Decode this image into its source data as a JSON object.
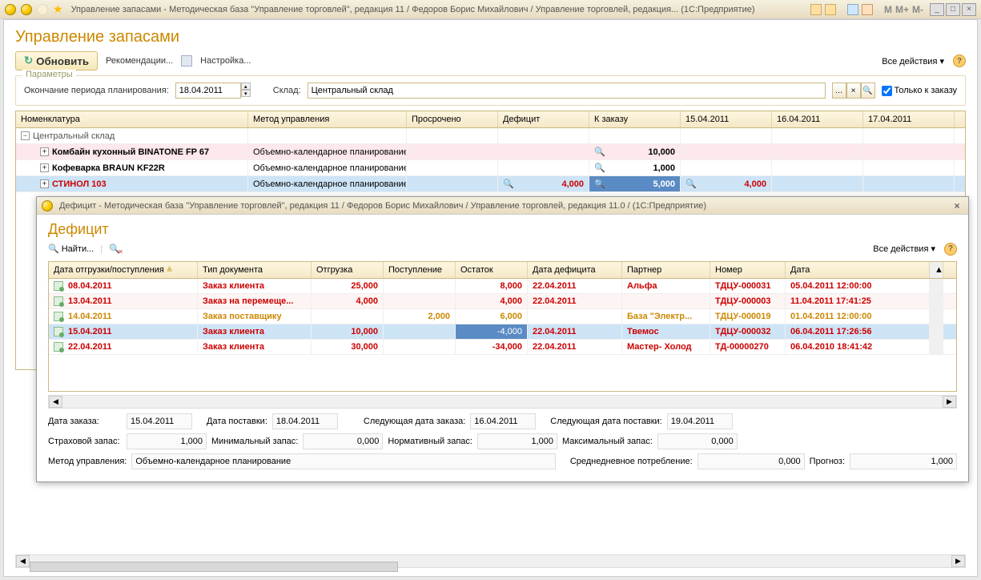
{
  "titlebar": "Управление запасами - Методическая база \"Управление торговлей\", редакция 11 / Федоров Борис Михайлович / Управление торговлей, редакция...  (1С:Предприятие)",
  "mem_labels": {
    "m": "M",
    "mplus": "M+",
    "mminus": "M-"
  },
  "page_title": "Управление запасами",
  "toolbar": {
    "refresh": "Обновить",
    "recommend": "Рекомендации...",
    "settings": "Настройка...",
    "all_actions": "Все действия"
  },
  "params": {
    "legend": "Параметры",
    "plan_end_label": "Окончание периода планирования:",
    "plan_end_value": "18.04.2011",
    "warehouse_label": "Склад:",
    "warehouse_value": "Центральный склад",
    "only_to_order": "Только к заказу"
  },
  "grid": {
    "headers": {
      "nom": "Номенклатура",
      "met": "Метод управления",
      "pros": "Просрочено",
      "def": "Дефицит",
      "zak": "К заказу",
      "d1": "15.04.2011",
      "d2": "16.04.2011",
      "d3": "17.04.2011"
    },
    "group": "Центральный склад",
    "rows": [
      {
        "nom": "Комбайн кухонный BINATONE FP 67",
        "met": "Объемно-календарное планирование",
        "pros": "",
        "def": "",
        "zak": "10,000",
        "d1": "",
        "d2": "",
        "d3": ""
      },
      {
        "nom": "Кофеварка BRAUN KF22R",
        "met": "Объемно-календарное планирование",
        "pros": "",
        "def": "",
        "zak": "1,000",
        "d1": "",
        "d2": "",
        "d3": ""
      },
      {
        "nom": "СТИНОЛ 103",
        "met": "Объемно-календарное планирование",
        "pros": "",
        "def": "4,000",
        "zak": "5,000",
        "d1": "4,000",
        "d2": "",
        "d3": ""
      }
    ]
  },
  "child": {
    "titlebar": "Дефицит - Методическая база \"Управление торговлей\", редакция 11 / Федоров Борис Михайлович / Управление торговлей, редакция 11.0 /  (1С:Предприятие)",
    "page_title": "Дефицит",
    "toolbar": {
      "find": "Найти...",
      "all_actions": "Все действия"
    },
    "grid": {
      "headers": {
        "do": "Дата отгрузки/поступления",
        "td": "Тип документа",
        "og": "Отгрузка",
        "ps": "Поступление",
        "os": "Остаток",
        "dd": "Дата дефицита",
        "pa": "Партнер",
        "no": "Номер",
        "da": "Дата"
      },
      "rows": [
        {
          "do": "08.04.2011",
          "td": "Заказ клиента",
          "og": "25,000",
          "ps": "",
          "os": "8,000",
          "dd": "22.04.2011",
          "pa": "Альфа",
          "no": "ТДЦУ-000031",
          "da": "05.04.2011 12:00:00",
          "style": "red"
        },
        {
          "do": "13.04.2011",
          "td": "Заказ на перемеще...",
          "og": "4,000",
          "ps": "",
          "os": "4,000",
          "dd": "22.04.2011",
          "pa": "",
          "no": "ТДЦУ-000003",
          "da": "11.04.2011 17:41:25",
          "style": "red"
        },
        {
          "do": "14.04.2011",
          "td": "Заказ поставщику",
          "og": "",
          "ps": "2,000",
          "os": "6,000",
          "dd": "",
          "pa": "База \"Электр...",
          "no": "ТДЦУ-000019",
          "da": "01.04.2011 12:00:00",
          "style": "orange"
        },
        {
          "do": "15.04.2011",
          "td": "Заказ клиента",
          "og": "10,000",
          "ps": "",
          "os": "-4,000",
          "dd": "22.04.2011",
          "pa": "Твемос",
          "no": "ТДЦУ-000032",
          "da": "06.04.2011 17:26:56",
          "style": "sel"
        },
        {
          "do": "22.04.2011",
          "td": "Заказ клиента",
          "og": "30,000",
          "ps": "",
          "os": "-34,000",
          "dd": "22.04.2011",
          "pa": "Мастер- Холод",
          "no": "ТД-00000270",
          "da": "06.04.2010 18:41:42",
          "style": "red"
        }
      ]
    },
    "form": {
      "order_date_lbl": "Дата заказа:",
      "order_date_val": "15.04.2011",
      "deliv_date_lbl": "Дата поставки:",
      "deliv_date_val": "18.04.2011",
      "next_order_lbl": "Следующая дата заказа:",
      "next_order_val": "16.04.2011",
      "next_deliv_lbl": "Следующая дата поставки:",
      "next_deliv_val": "19.04.2011",
      "safety_lbl": "Страховой запас:",
      "safety_val": "1,000",
      "min_lbl": "Минимальный запас:",
      "min_val": "0,000",
      "norm_lbl": "Нормативный запас:",
      "norm_val": "1,000",
      "max_lbl": "Максимальный запас:",
      "max_val": "0,000",
      "method_lbl": "Метод управления:",
      "method_val": "Объемно-календарное планирование",
      "avg_lbl": "Среднедневное потребление:",
      "avg_val": "0,000",
      "forecast_lbl": "Прогноз:",
      "forecast_val": "1,000"
    }
  }
}
